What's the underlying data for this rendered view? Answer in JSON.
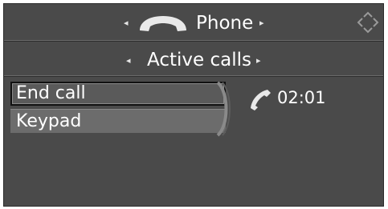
{
  "header": {
    "title": "Phone",
    "left_arrow": "◂",
    "right_arrow": "▸",
    "icon": "phone-handset-icon"
  },
  "subheader": {
    "title": "Active calls",
    "left_arrow": "◂",
    "right_arrow": "▸"
  },
  "menu": {
    "items": [
      {
        "label": "End call",
        "selected": true
      },
      {
        "label": "Keypad",
        "selected": false
      }
    ]
  },
  "call": {
    "icon": "phone-handset-icon",
    "duration": "02:01"
  },
  "colors": {
    "background": "#4a4a4a",
    "text": "#ffffff",
    "selected_item": "#5a5a5a",
    "item": "#6c6c6c"
  }
}
